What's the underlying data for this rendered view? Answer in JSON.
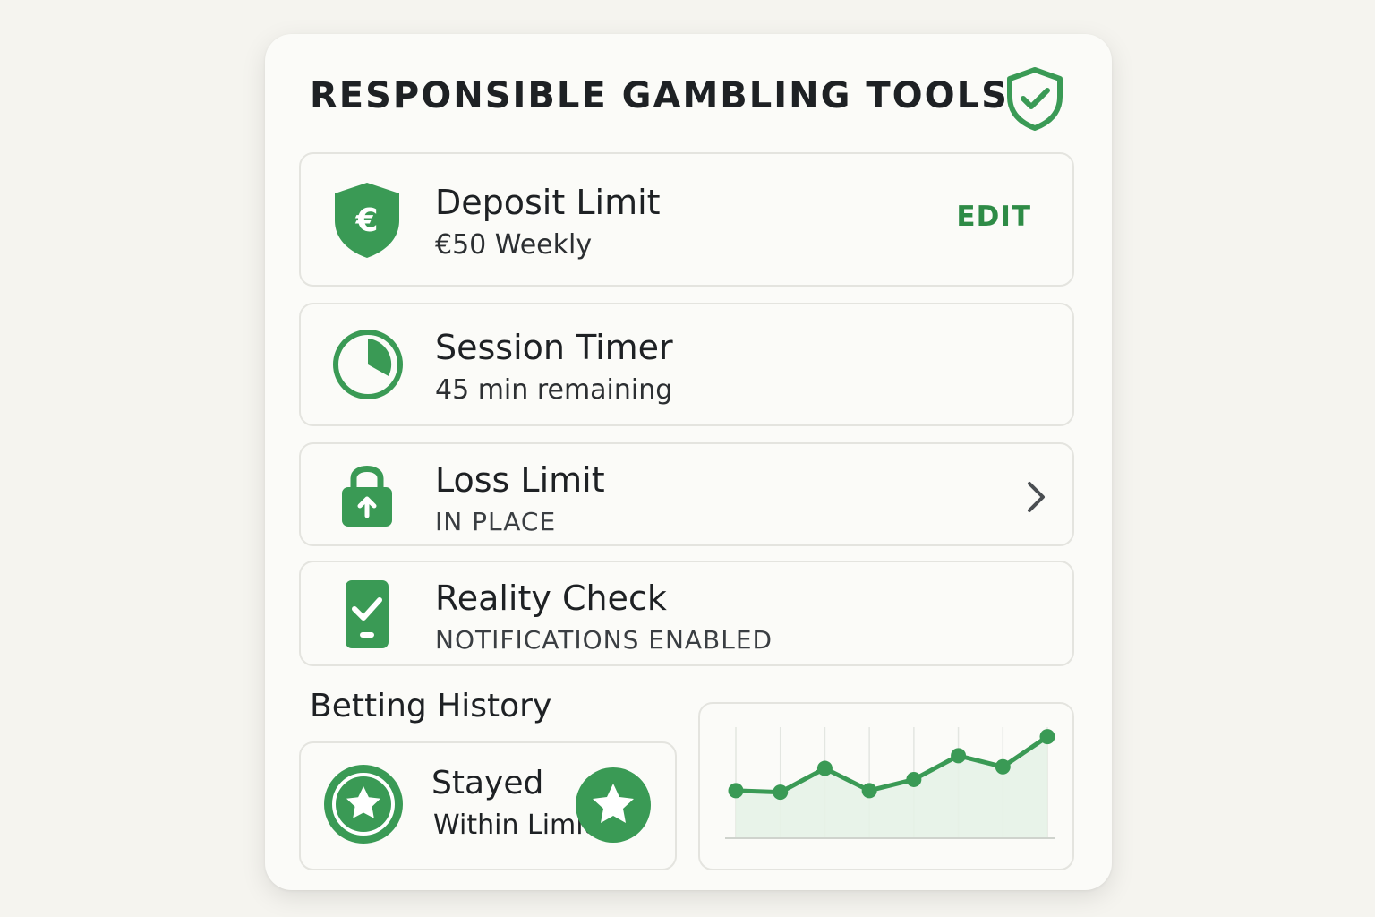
{
  "header": {
    "title": "RESPONSIBLE GAMBLING TOOLS",
    "icon": "shield-check-icon"
  },
  "tools": [
    {
      "name": "Deposit Limit",
      "detail": "€50 Weekly",
      "icon": "euro-shield-icon",
      "action": "EDIT"
    },
    {
      "name": "Session Timer",
      "detail": "45 min remaining",
      "icon": "clock-timer-icon"
    },
    {
      "name": "Loss Limit",
      "detail": "IN PLACE",
      "icon": "padlock-icon",
      "action_icon": "chevron-right-icon"
    },
    {
      "name": "Reality Check",
      "detail": "NOTIFICATIONS ENABLED",
      "icon": "phone-check-icon"
    }
  ],
  "betting_history": {
    "title": "Betting History",
    "badge": {
      "line1": "Stayed",
      "line2": "Within Limit",
      "icon": "star-badge-icon",
      "overlay_icon": "star-circle-icon"
    }
  },
  "theme": {
    "accent": "#3a9a55",
    "dark_accent": "#2e8b46",
    "fill": "#e6f2e7"
  },
  "chart_data": {
    "type": "area",
    "x": [
      1,
      2,
      3,
      4,
      5,
      6,
      7,
      8
    ],
    "values": [
      3.0,
      2.9,
      4.4,
      3.0,
      3.7,
      5.2,
      4.5,
      6.4
    ],
    "ylim": [
      0,
      7
    ],
    "grid": true,
    "title": "",
    "xlabel": "",
    "ylabel": ""
  }
}
